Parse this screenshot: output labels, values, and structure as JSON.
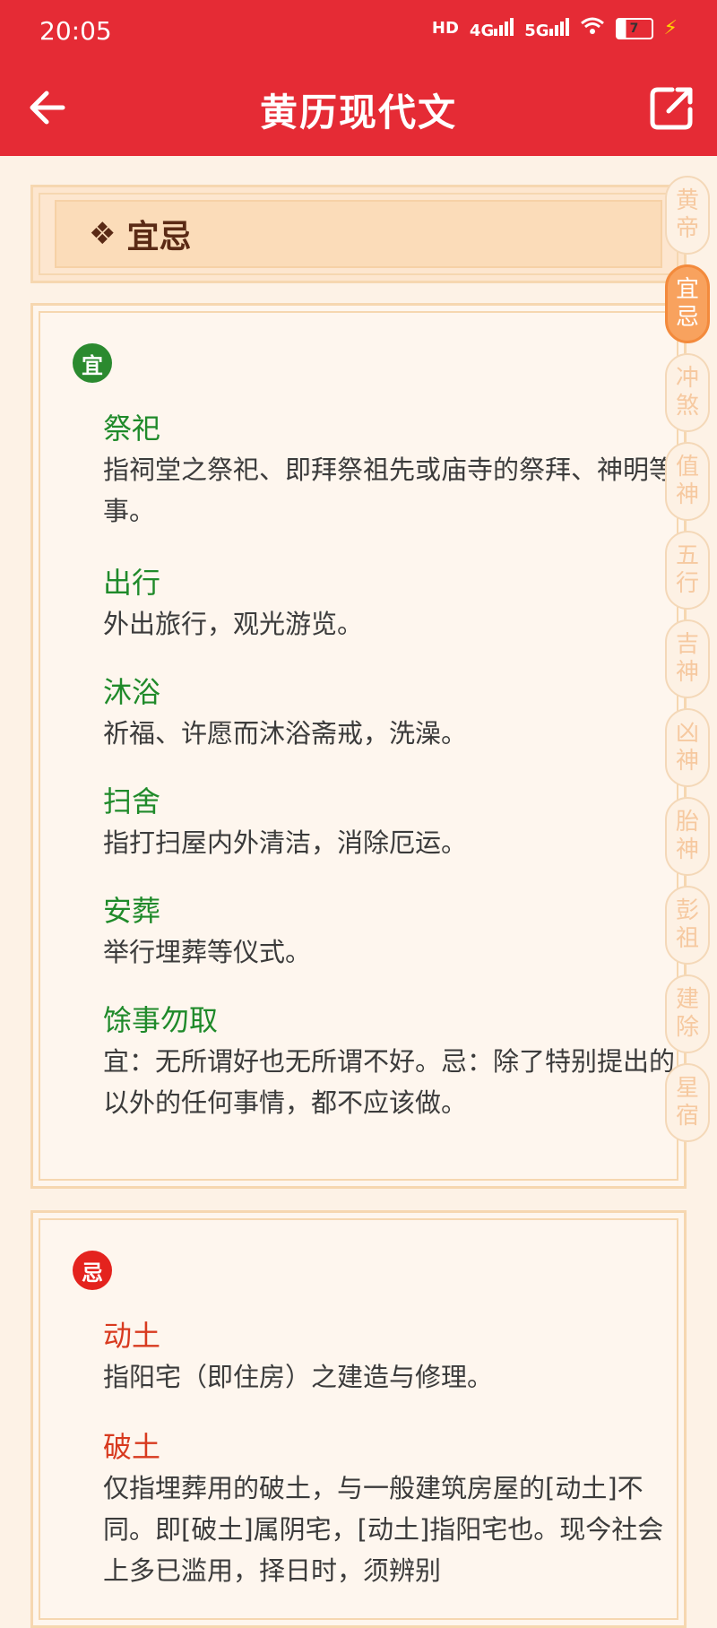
{
  "status": {
    "time": "20:05",
    "hd": "HD",
    "net1": "4G",
    "net2": "5G",
    "battery": "7"
  },
  "appbar": {
    "title": "黄历现代文"
  },
  "header_card": {
    "symbol": "❖",
    "label": "宜忌"
  },
  "good": {
    "badge": "宜",
    "items": [
      {
        "title": "祭祀",
        "desc": "指祠堂之祭祀、即拜祭祖先或庙寺的祭拜、神明等事。"
      },
      {
        "title": "出行",
        "desc": "外出旅行，观光游览。"
      },
      {
        "title": "沐浴",
        "desc": "祈福、许愿而沐浴斋戒，洗澡。"
      },
      {
        "title": "扫舍",
        "desc": "指打扫屋内外清洁，消除厄运。"
      },
      {
        "title": "安葬",
        "desc": "举行埋葬等仪式。"
      },
      {
        "title": "馀事勿取",
        "desc": "宜：无所谓好也无所谓不好。忌：除了特别提出的以外的任何事情，都不应该做。"
      }
    ]
  },
  "bad": {
    "badge": "忌",
    "items": [
      {
        "title": "动土",
        "desc": "指阳宅（即住房）之建造与修理。"
      },
      {
        "title": "破土",
        "desc": "仅指埋葬用的破土，与一般建筑房屋的[动土]不同。即[破土]属阴宅，[动土]指阳宅也。现今社会上多已滥用，择日时，须辨别"
      }
    ]
  },
  "sidenav": [
    {
      "label": "黄帝",
      "active": false
    },
    {
      "label": "宜忌",
      "active": true
    },
    {
      "label": "冲煞",
      "active": false
    },
    {
      "label": "值神",
      "active": false
    },
    {
      "label": "五行",
      "active": false
    },
    {
      "label": "吉神",
      "active": false
    },
    {
      "label": "凶神",
      "active": false
    },
    {
      "label": "胎神",
      "active": false
    },
    {
      "label": "彭祖",
      "active": false
    },
    {
      "label": "建除",
      "active": false
    },
    {
      "label": "星宿",
      "active": false
    }
  ]
}
